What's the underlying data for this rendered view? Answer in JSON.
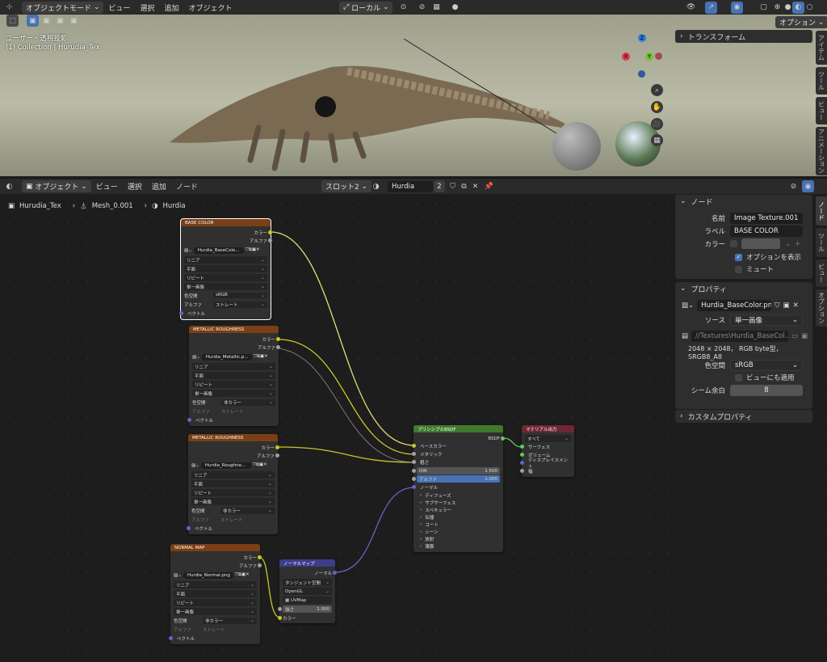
{
  "top_header": {
    "mode": "オブジェクトモード",
    "menus": [
      "ビュー",
      "選択",
      "追加",
      "オブジェクト"
    ],
    "transform_orientation": "ローカル",
    "options": "オプション"
  },
  "viewport": {
    "view_name": "ユーザー・透視投影",
    "collection_info": "(1) Collection | Hurudia_Tex",
    "transform_panel": "トランスフォーム",
    "gizmo": {
      "z": "Z",
      "y": "Y",
      "x": "X"
    },
    "side_tabs": [
      "アイテム",
      "ツール",
      "ビュー",
      "アニメーション"
    ]
  },
  "node_header": {
    "mode": "オブジェクト",
    "menus": [
      "ビュー",
      "選択",
      "追加",
      "ノード"
    ],
    "slot": "スロット2",
    "material": "Hurdia",
    "users": "2"
  },
  "breadcrumb": [
    "Hurudia_Tex",
    "Mesh_0.001",
    "Hurdia"
  ],
  "sidebar": {
    "tabs": [
      "ノード",
      "ツール",
      "ビュー",
      "オプション"
    ],
    "node_panel": {
      "title": "ノード",
      "name_label": "名前",
      "name_value": "Image Texture.001",
      "label_label": "ラベル",
      "label_value": "BASE COLOR",
      "color_label": "カラー",
      "show_options": "オプションを表示",
      "mute": "ミュート"
    },
    "props_panel": {
      "title": "プロパティ",
      "image_name": "Hurdia_BaseColor.png",
      "source_label": "ソース",
      "source_value": "単一画像",
      "filepath": "//Textures\\Hurdia_BaseCol...",
      "info": "2048 × 2048，  RGB byte型，SRGB8_A8",
      "colorspace_label": "色空間",
      "colorspace_value": "sRGB",
      "view_as_render": "ビューにも適用",
      "seam_label": "シーム余白",
      "seam_value": "8"
    },
    "custom_props": "カスタムプロパティ"
  },
  "nodes": {
    "tex_common": {
      "out_color": "カラー",
      "out_alpha": "アルファ",
      "in_vector": "ベクトル",
      "interp": "リニア",
      "proj": "平面",
      "ext": "リピート",
      "src": "単一画像",
      "cs_label": "色空間",
      "alpha_label": "アルファ",
      "alpha_mode": "ストレート"
    },
    "base": {
      "title": "BASE COLOR",
      "image": "Hurdia_BaseColo...",
      "colorspace": "sRGB"
    },
    "metal": {
      "title": "METALLIC ROUGHNESS",
      "image": "Hurdia_Metallic.p...",
      "colorspace": "非カラー"
    },
    "rough": {
      "title": "METALLIC ROUGHNESS",
      "image": "Hurdia_Roughne...",
      "colorspace": "非カラー"
    },
    "normal_tex": {
      "title": "NORMAL MAP",
      "image": "Hurdia_Normal.png",
      "colorspace": "非カラー"
    },
    "normalmap": {
      "title": "ノーマルマップ",
      "out": "ノーマル",
      "space": "タンジェント空間",
      "uv_label": "OpenGL",
      "uvmap": "UVMap",
      "strength_label": "強さ",
      "strength": "1.000",
      "in_color": "カラー"
    },
    "bsdf": {
      "title": "プリンシプルBSDF",
      "out": "BSDF",
      "inputs": [
        "ベースカラー",
        "メタリック",
        "粗さ"
      ],
      "ior_label": "IOR",
      "ior": "1.500",
      "alpha_label": "アルファ",
      "alpha": "1.000",
      "normal": "ノーマル",
      "groups": [
        "ディフューズ",
        "サブサーフェス",
        "スペキュラー",
        "伝播",
        "コート",
        "シーン",
        "放射",
        "薄膜"
      ]
    },
    "output": {
      "title": "マテリアル出力",
      "target": "すべて",
      "inputs": [
        "サーフェス",
        "ボリューム",
        "ディスプレイスメント",
        "幅"
      ]
    }
  },
  "colors": {
    "texture_header": "#7a3f16",
    "bsdf_header": "#3f7a2e",
    "output_header": "#6e2733",
    "vector_header": "#3d3d8a",
    "link_yellow": "#c7c729",
    "link_gray": "#a1a1a1",
    "link_purple": "#6363c7",
    "accent_blue": "#4772b3"
  }
}
